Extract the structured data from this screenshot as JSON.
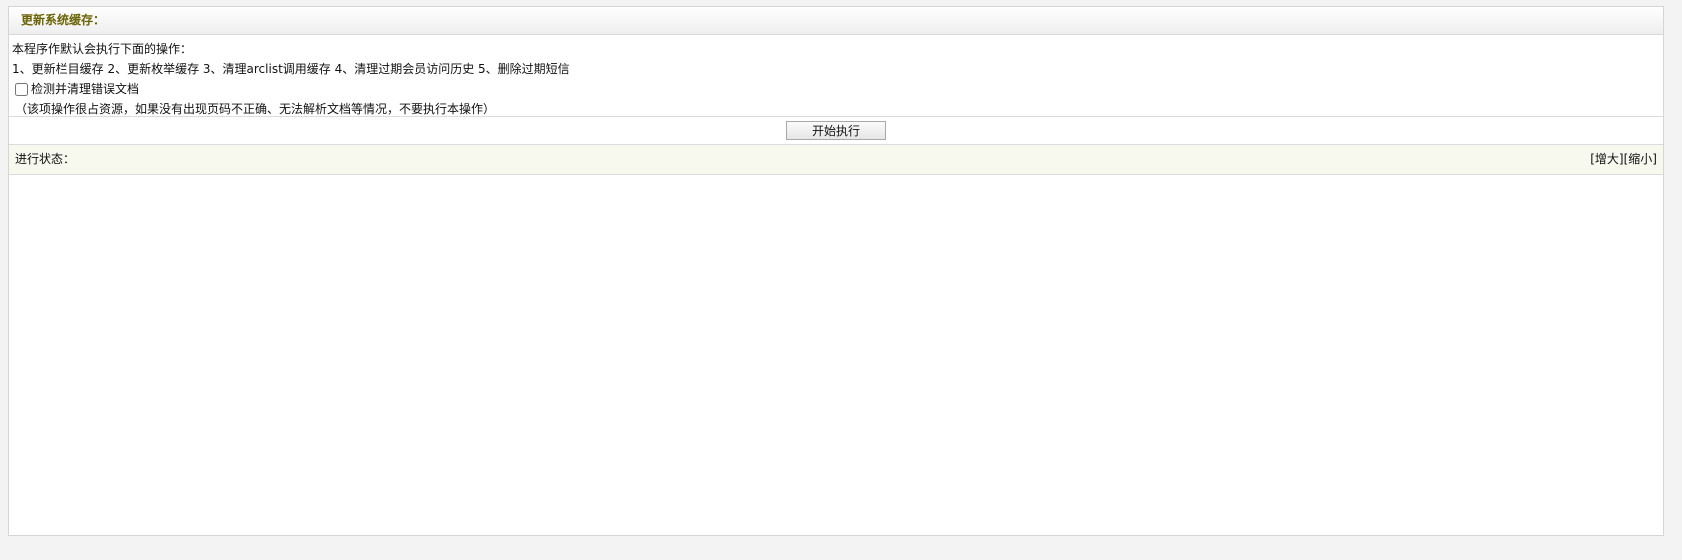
{
  "panel": {
    "title": "更新系统缓存："
  },
  "description": {
    "intro": "本程序作默认会执行下面的操作：",
    "operations": "1、更新栏目缓存 2、更新枚举缓存 3、清理arclist调用缓存 4、清理过期会员访问历史 5、删除过期短信",
    "checkbox_label": "检测并清理错误文档",
    "checkbox_checked": false,
    "note": "（该项操作很占资源，如果没有出现页码不正确、无法解析文档等情况，不要执行本操作）"
  },
  "actions": {
    "start_label": "开始执行"
  },
  "status": {
    "label": "进行状态：",
    "enlarge_label": "[增大]",
    "shrink_label": "[缩小]",
    "body_text": ""
  }
}
